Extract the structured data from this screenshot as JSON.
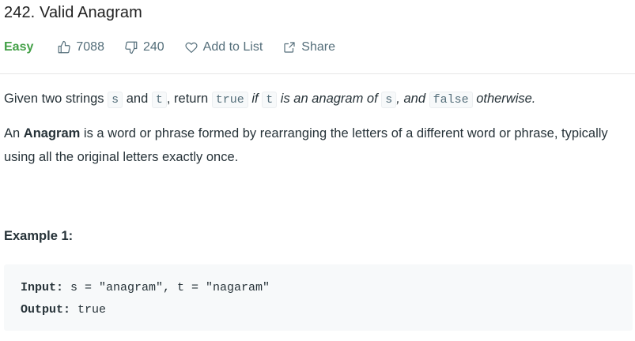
{
  "problem": {
    "title": "242. Valid Anagram",
    "difficulty": "Easy",
    "likes": "7088",
    "dislikes": "240",
    "add_to_list": "Add to List",
    "share": "Share"
  },
  "description": {
    "p1": {
      "t1": "Given two strings ",
      "c1": "s",
      "t2": " and ",
      "c2": "t",
      "t3": ", return ",
      "c3": "true",
      "t4": " ",
      "e1": "if ",
      "c4": "t",
      "e2": " is an anagram of ",
      "c5": "s",
      "e3": ", and ",
      "c6": "false",
      "e4": " otherwise."
    },
    "p2": {
      "t1": "An ",
      "b1": "Anagram",
      "t2": " is a word or phrase formed by rearranging the letters of a different word or phrase, typically using all the original letters exactly once."
    }
  },
  "example1": {
    "title": "Example 1:",
    "input_label": "Input:",
    "input_value": " s = \"anagram\", t = \"nagaram\"",
    "output_label": "Output:",
    "output_value": " true"
  },
  "colors": {
    "easy": "#43a047",
    "text": "#263238",
    "muted": "#546e7a",
    "code_bg": "#f7f9fa"
  },
  "icons": [
    "thumbs-up-icon",
    "thumbs-down-icon",
    "heart-icon",
    "share-icon"
  ]
}
